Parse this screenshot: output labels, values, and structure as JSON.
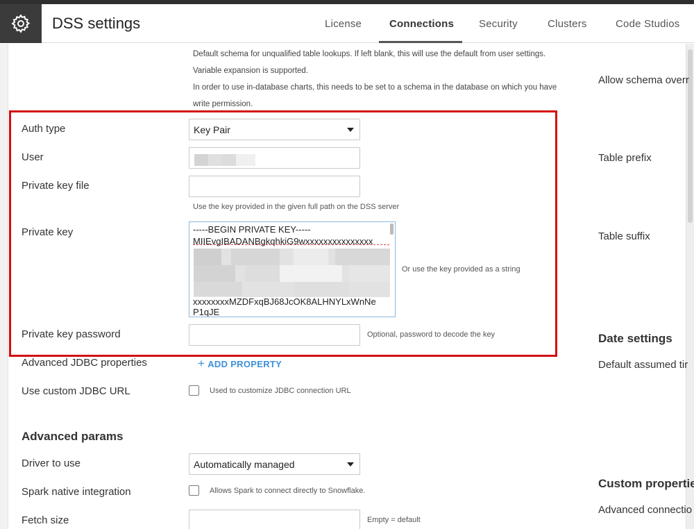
{
  "header": {
    "title": "DSS settings",
    "tabs": [
      {
        "label": "License"
      },
      {
        "label": "Connections",
        "active": true
      },
      {
        "label": "Security"
      },
      {
        "label": "Clusters"
      },
      {
        "label": "Code Studios"
      }
    ]
  },
  "schema_description": {
    "line1": "Default schema for unqualified table lookups. If left blank, this will use the default from user settings.",
    "line2": "Variable expansion is supported.",
    "line3": "In order to use in-database charts, this needs to be set to a schema in the database on which you have",
    "line4": "write permission."
  },
  "form": {
    "auth_type": {
      "label": "Auth type",
      "value": "Key Pair"
    },
    "user": {
      "label": "User",
      "value": ""
    },
    "private_key_file": {
      "label": "Private key file",
      "value": "",
      "hint": "Use the key provided in the given full path on the DSS server"
    },
    "private_key": {
      "label": "Private key",
      "line1": "-----BEGIN PRIVATE KEY-----",
      "line2": "MIIEvgIBADANBgkqhkiG9wxxxxxxxxxxxxxxx",
      "line3": "xxxxxxxxMZDFxqBJ68JcOK8ALHNYLxWnNe",
      "line4": "P1qJE",
      "hint": "Or use the key provided as a string"
    },
    "private_key_password": {
      "label": "Private key password",
      "value": "",
      "hint": "Optional, password to decode the key"
    },
    "advanced_jdbc": {
      "label": "Advanced JDBC properties",
      "button": "ADD PROPERTY"
    },
    "custom_jdbc_url": {
      "label": "Use custom JDBC URL",
      "hint": "Used to customize JDBC connection URL",
      "checked": false
    }
  },
  "advanced": {
    "title": "Advanced params",
    "driver": {
      "label": "Driver to use",
      "value": "Automatically managed"
    },
    "spark": {
      "label": "Spark native integration",
      "hint": "Allows Spark to connect directly to Snowflake.",
      "checked": false
    },
    "fetch_size": {
      "label": "Fetch size",
      "value": "",
      "hint": "Empty = default"
    }
  },
  "right_column": {
    "allow_schema": "Allow schema overr",
    "table_prefix": "Table prefix",
    "table_suffix": "Table suffix",
    "date_settings": "Date settings",
    "default_assumed": "Default assumed tir",
    "custom_properties": "Custom propertie",
    "advanced_connection": "Advanced connectio"
  },
  "colors": {
    "highlight": "#d40d12",
    "link": "#3d8fd8",
    "header_icon_bg": "#3b3b3b"
  }
}
